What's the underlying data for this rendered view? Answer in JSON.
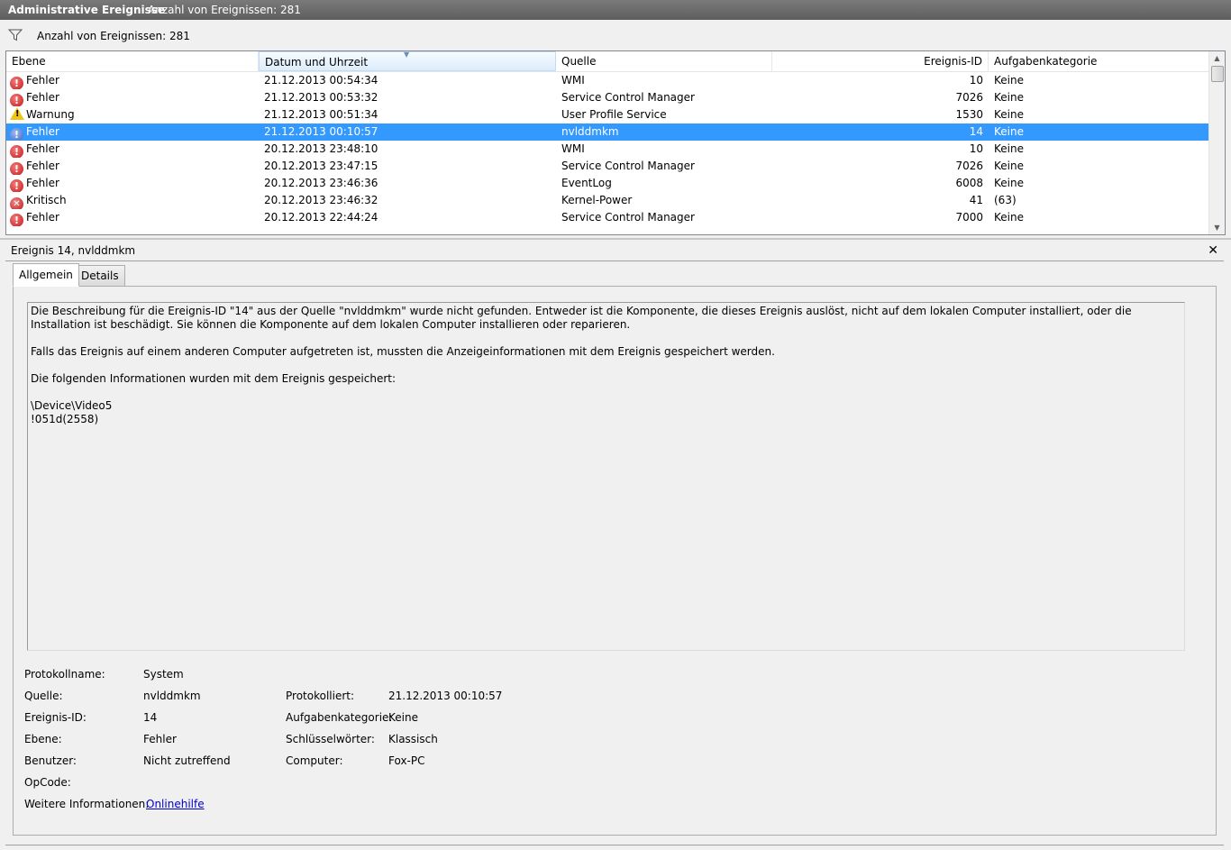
{
  "titlebar": {
    "title": "Administrative Ereignisse",
    "count": "Anzahl von Ereignissen: 281"
  },
  "filter": {
    "text": "Anzahl von Ereignissen: 281",
    "icon": "filter-icon"
  },
  "grid": {
    "columns": [
      "Ebene",
      "Datum und Uhrzeit",
      "Quelle",
      "Ereignis-ID",
      "Aufgabenkategorie"
    ],
    "sorted_column": "Datum und Uhrzeit",
    "rows": [
      {
        "level": "Fehler",
        "icon": "error-icon",
        "date": "21.12.2013 00:54:34",
        "source": "WMI",
        "id": "10",
        "category": "Keine"
      },
      {
        "level": "Fehler",
        "icon": "error-icon",
        "date": "21.12.2013 00:53:32",
        "source": "Service Control Manager",
        "id": "7026",
        "category": "Keine"
      },
      {
        "level": "Warnung",
        "icon": "warning-icon",
        "date": "21.12.2013 00:51:34",
        "source": "User Profile Service",
        "id": "1530",
        "category": "Keine"
      },
      {
        "level": "Fehler",
        "icon": "error-icon",
        "date": "21.12.2013 00:10:57",
        "source": "nvlddmkm",
        "id": "14",
        "category": "Keine",
        "selected": true
      },
      {
        "level": "Fehler",
        "icon": "error-icon",
        "date": "20.12.2013 23:48:10",
        "source": "WMI",
        "id": "10",
        "category": "Keine"
      },
      {
        "level": "Fehler",
        "icon": "error-icon",
        "date": "20.12.2013 23:47:15",
        "source": "Service Control Manager",
        "id": "7026",
        "category": "Keine"
      },
      {
        "level": "Fehler",
        "icon": "error-icon",
        "date": "20.12.2013 23:46:36",
        "source": "EventLog",
        "id": "6008",
        "category": "Keine"
      },
      {
        "level": "Kritisch",
        "icon": "critical-icon",
        "date": "20.12.2013 23:46:32",
        "source": "Kernel-Power",
        "id": "41",
        "category": "(63)"
      },
      {
        "level": "Fehler",
        "icon": "error-icon",
        "date": "20.12.2013 22:44:24",
        "source": "Service Control Manager",
        "id": "7000",
        "category": "Keine"
      }
    ]
  },
  "detail": {
    "title": "Ereignis 14, nvlddmkm",
    "close": "✕",
    "tabs": [
      "Allgemein",
      "Details"
    ],
    "active_tab": "Allgemein",
    "description": [
      "Die Beschreibung für die Ereignis-ID \"14\" aus der Quelle \"nvlddmkm\" wurde nicht gefunden. Entweder ist die Komponente, die dieses Ereignis auslöst, nicht auf dem lokalen Computer installiert, oder die Installation ist beschädigt. Sie können die Komponente auf dem lokalen Computer installieren oder reparieren.",
      "",
      "Falls das Ereignis auf einem anderen Computer aufgetreten ist, mussten die Anzeigeinformationen mit dem Ereignis gespeichert werden.",
      "",
      "Die folgenden Informationen wurden mit dem Ereignis gespeichert:",
      "",
      "\\Device\\Video5",
      "!051d(2558)"
    ],
    "props": {
      "protokollname_label": "Protokollname:",
      "protokollname": "System",
      "quelle_label": "Quelle:",
      "quelle": "nvlddmkm",
      "protokolliert_label": "Protokolliert:",
      "protokolliert": "21.12.2013 00:10:57",
      "ereignis_id_label": "Ereignis-ID:",
      "ereignis_id": "14",
      "aufgabenkategorie_label": "Aufgabenkategorie:",
      "aufgabenkategorie": "Keine",
      "ebene_label": "Ebene:",
      "ebene": "Fehler",
      "schluesselwoerter_label": "Schlüsselwörter:",
      "schluesselwoerter": "Klassisch",
      "benutzer_label": "Benutzer:",
      "benutzer": "Nicht zutreffend",
      "computer_label": "Computer:",
      "computer": "Fox-PC",
      "opcode_label": "OpCode:",
      "opcode": "",
      "weitere_label": "Weitere Informationen:",
      "weitere_link": "Onlinehilfe"
    }
  }
}
